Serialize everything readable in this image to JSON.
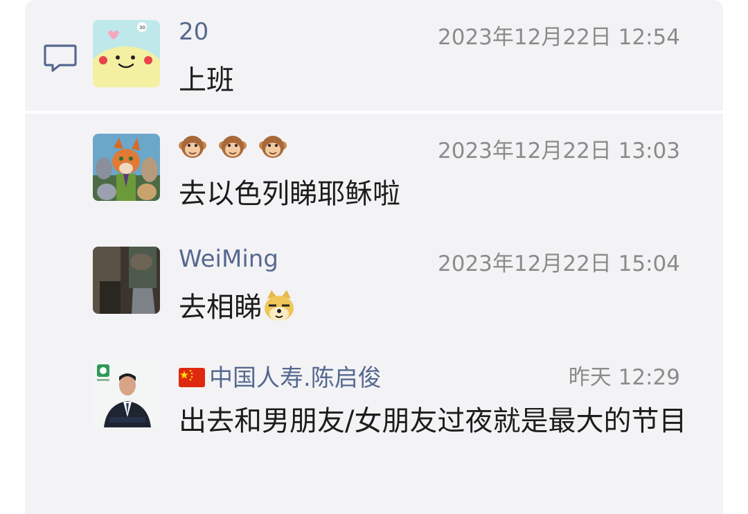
{
  "comments": [
    {
      "name": "20",
      "time": "2023年12月22日 12:54",
      "text": "上班",
      "avatar_icon": "yellow-smiley-avatar"
    },
    {
      "name": "🐵🐵🐵",
      "time": "2023年12月22日 13:03",
      "text": "去以色列睇耶稣啦",
      "avatar_icon": "zootopia-cartoon-avatar"
    },
    {
      "name": "WeiMing",
      "time": "2023年12月22日 15:04",
      "text": "去相睇",
      "avatar_icon": "dark-photo-avatar"
    },
    {
      "name": "中国人寿.陈启俊",
      "time": "昨天 12:29",
      "text": "出去和男朋友/女朋友过夜就是最大的节目",
      "avatar_icon": "business-portrait-avatar"
    }
  ],
  "icons": {
    "comment": "comment-bubble-icon",
    "monkey": "monkey-face-emoji",
    "doge": "doge-emoji",
    "flag": "china-flag-emoji"
  },
  "colors": {
    "panel_bg": "#f3f3f5",
    "name": "#56688f",
    "time": "#8b8b8b",
    "text": "#1c1c1c"
  }
}
